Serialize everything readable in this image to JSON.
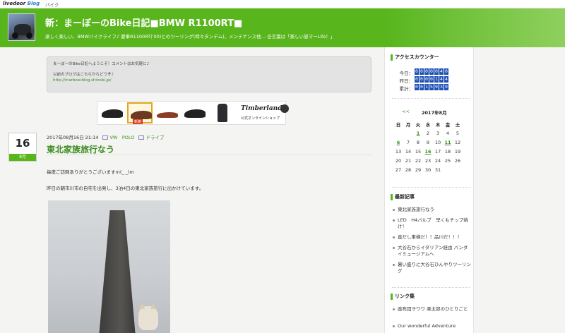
{
  "topbar": {
    "logo_a": "livedoor",
    "logo_b": "Blog",
    "category": "バイク"
  },
  "header": {
    "title": "新：まーぼーのBike日記■BMW R1100RT■",
    "description": "楽しく楽しい、BMWバイクライフ♪ 愛車R1100RT('00)とのツーリング(時々タンデム)、メンテナンス他… 合言葉は「楽しい旅マーLife！」"
  },
  "notice": {
    "line1": "まーぼーのBike日記へようこそ！コメントはお気軽に♪",
    "line2": "以前のブログはこちらからどうぞ♪",
    "link": "http://marbow.blog.shinobi.jp/"
  },
  "ad": {
    "brand": "Timberland",
    "sub": "公式オンラインショップ",
    "tag": "新着"
  },
  "post": {
    "day": "16",
    "month": "8月",
    "datetime": "2017年08月16日 21:14",
    "tag1": "VW　POLO",
    "tag2": "ドライブ",
    "title": "東北家族旅行なう",
    "p1": "毎度ご訪問ありがとうございますm(_ _)m",
    "p2": "昨日の朝市川市の自宅を出発し、3泊4日の東北家族旅行に出かけています。"
  },
  "sidebar": {
    "counter": {
      "heading": "アクセスカウンター",
      "today_label": "今日：",
      "today": "0000040",
      "yesterday_label": "昨日：",
      "yesterday": "0000144",
      "total_label": "累計：",
      "total": "0015939"
    },
    "calendar": {
      "prev": "<<",
      "title": "2017年8月",
      "weekdays": [
        "日",
        "月",
        "火",
        "水",
        "木",
        "金",
        "土"
      ],
      "weeks": [
        [
          "",
          "",
          "1",
          "2",
          "3",
          "4",
          "5"
        ],
        [
          "6",
          "7",
          "8",
          "9",
          "10",
          "11",
          "12"
        ],
        [
          "13",
          "14",
          "15",
          "16",
          "17",
          "18",
          "19"
        ],
        [
          "20",
          "21",
          "22",
          "23",
          "24",
          "25",
          "26"
        ],
        [
          "27",
          "28",
          "29",
          "30",
          "31",
          "",
          ""
        ]
      ],
      "linked_days": [
        "1",
        "6",
        "11",
        "16"
      ]
    },
    "recent": {
      "heading": "最新記事",
      "items": [
        "東北家族旅行なう",
        "LED　H4バルブ　早くもチップ焼け！",
        "直だし車検だ！！品川だ！！！",
        "大谷石からイタリアン経由 バンダイミュージアムへ",
        "暑い盛りに大谷石ひんやりツーリング"
      ]
    },
    "links": {
      "heading": "リンク集",
      "items": [
        "座布団ヲワワ 楽太郎のひとりごと",
        "Our wonderful Adventure"
      ]
    }
  },
  "colors": {
    "header_green": "#58b51c",
    "link_green": "#3a8d1e",
    "counter_blue": "#1d4fb5"
  }
}
